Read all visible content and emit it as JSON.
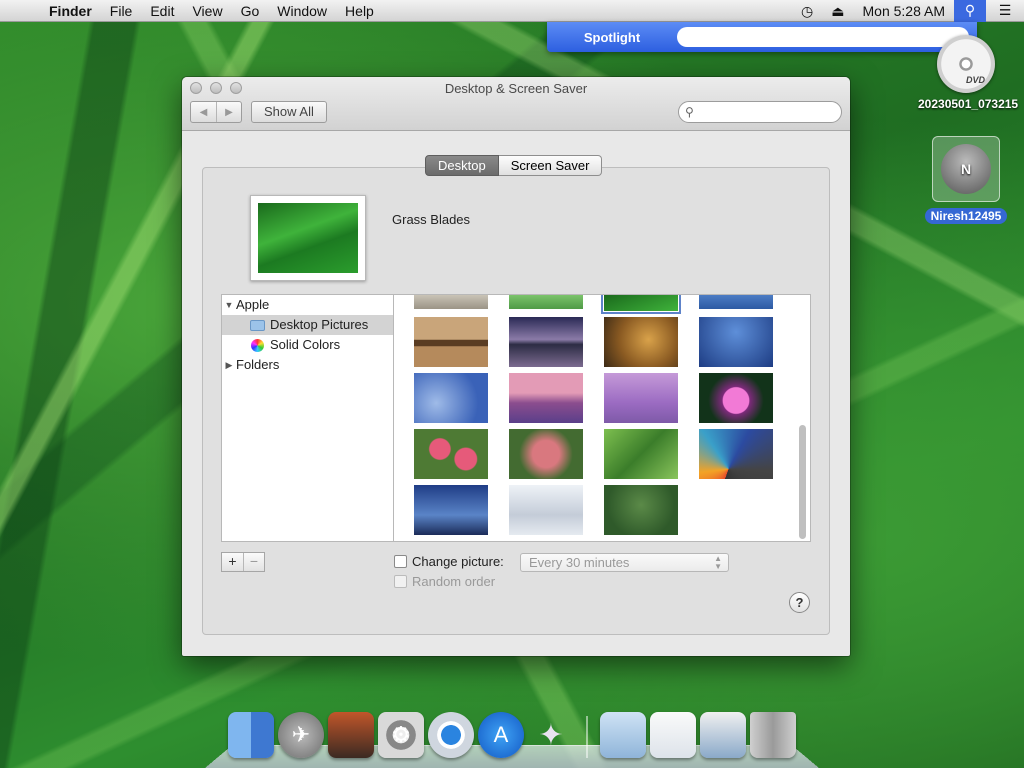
{
  "menubar": {
    "apple_icon": "",
    "app_name": "Finder",
    "items": [
      "File",
      "Edit",
      "View",
      "Go",
      "Window",
      "Help"
    ],
    "clock": "Mon 5:28 AM",
    "timemachine_icon": "◷",
    "eject_icon": "⏏",
    "spotlight_icon": "⚲",
    "list_icon": "☰"
  },
  "spotlight": {
    "label": "Spotlight",
    "value": ""
  },
  "desktop": {
    "dvd_label": "20230501_073215",
    "dvd_badge": "DVD",
    "user_label": "Niresh12495",
    "user_badge": "N"
  },
  "window": {
    "title": "Desktop & Screen Saver",
    "back_icon": "◀",
    "forward_icon": "▶",
    "show_all": "Show All",
    "search_placeholder": "",
    "search_icon": "⚲",
    "tabs": [
      "Desktop",
      "Screen Saver"
    ],
    "current_picture": "Grass Blades",
    "sources": {
      "group_apple": "Apple",
      "desktop_pictures": "Desktop Pictures",
      "solid_colors": "Solid Colors",
      "group_folders": "Folders"
    },
    "add_label": "+",
    "remove_label": "−",
    "change_picture_label": "Change picture:",
    "interval_value": "Every 30 minutes",
    "random_order_label": "Random order",
    "help_label": "?"
  },
  "colors": {
    "accent": "#3a69e0",
    "selection": "#3568d4"
  },
  "dock": {
    "icons": [
      "finder-icon",
      "launchpad-icon",
      "photo-booth-icon",
      "system-preferences-icon",
      "chrome-icon",
      "app-store-icon",
      "wizard-icon",
      "documents-folder-icon",
      "web-preview-icon",
      "window-thumb-icon",
      "trash-icon"
    ]
  }
}
